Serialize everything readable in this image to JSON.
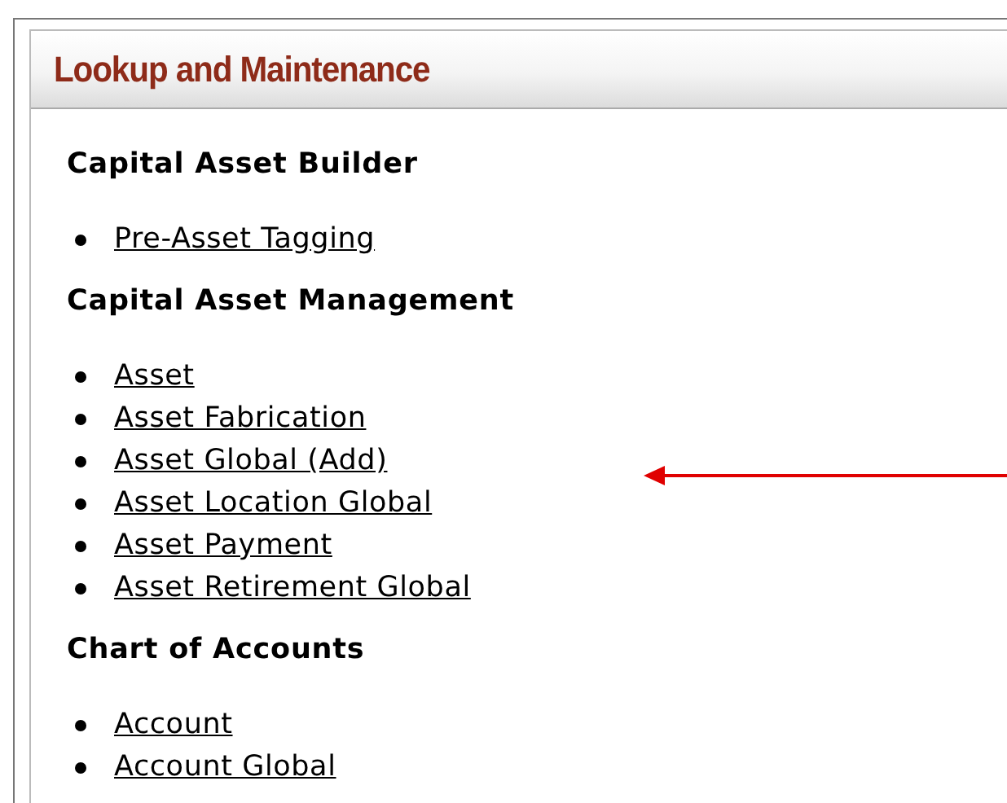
{
  "panel": {
    "title": "Lookup and Maintenance"
  },
  "sections": [
    {
      "heading": "Capital Asset Builder",
      "links": [
        "Pre-Asset Tagging"
      ]
    },
    {
      "heading": "Capital Asset Management",
      "links": [
        "Asset",
        "Asset Fabrication",
        "Asset Global (Add)",
        "Asset Location Global",
        "Asset Payment",
        "Asset Retirement Global"
      ]
    },
    {
      "heading": "Chart of Accounts",
      "links": [
        "Account",
        "Account Global"
      ]
    }
  ]
}
